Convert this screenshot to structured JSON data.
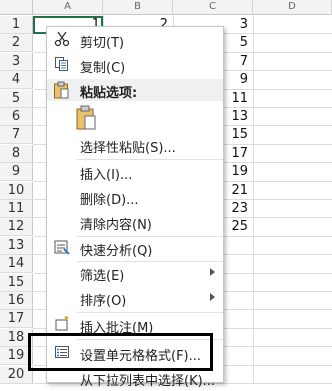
{
  "columns": [
    "A",
    "B",
    "C",
    "D"
  ],
  "rows": [
    "1",
    "2",
    "3",
    "4",
    "5",
    "6",
    "7",
    "8",
    "9",
    "10",
    "11",
    "12",
    "13",
    "14",
    "15",
    "16",
    "17",
    "18",
    "19",
    "20"
  ],
  "cells": {
    "a1": "1",
    "b1": "2",
    "c_values": [
      "3",
      "5",
      "7",
      "9",
      "11",
      "13",
      "15",
      "17",
      "19",
      "21",
      "23",
      "25"
    ]
  },
  "menu": {
    "cut": "剪切(T)",
    "copy": "复制(C)",
    "paste_options_header": "粘贴选项:",
    "paste_special": "选择性粘贴(S)...",
    "insert": "插入(I)...",
    "delete": "删除(D)...",
    "clear_contents": "清除内容(N)",
    "quick_analysis": "快速分析(Q)",
    "filter": "筛选(E)",
    "sort": "排序(O)",
    "insert_comment": "插入批注(M)",
    "format_cells": "设置单元格格式(F)...",
    "pick_from_list": "从下拉列表中选择(K)..."
  },
  "icons": {
    "cut": "scissors-icon",
    "copy": "copy-icon",
    "paste": "clipboard-icon",
    "quick_analysis": "quick-analysis-icon",
    "insert_comment": "comment-icon",
    "format_cells": "format-cells-icon"
  },
  "colors": {
    "selection": "#217346",
    "highlight_box": "#000000"
  }
}
